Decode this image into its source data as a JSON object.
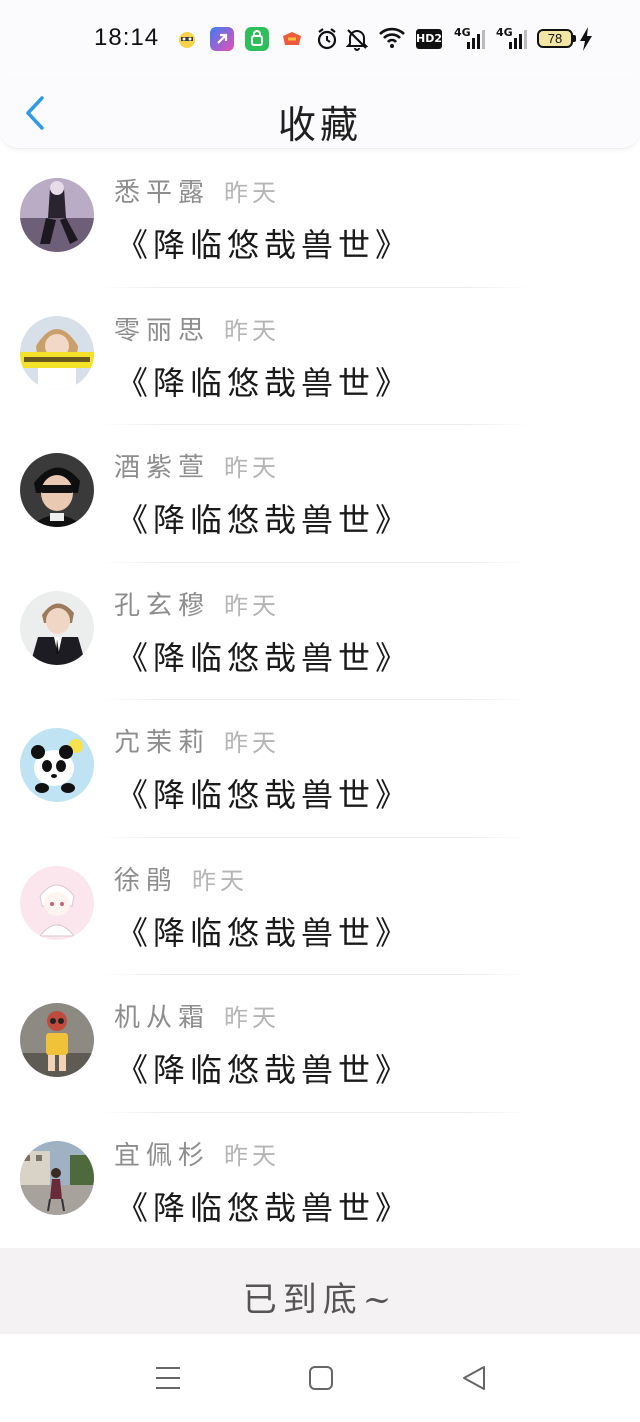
{
  "status_bar": {
    "time": "18:14",
    "hd_label": "HD2",
    "network_1": "4G",
    "network_2": "4G",
    "battery": "78"
  },
  "header": {
    "title": "收藏"
  },
  "items": [
    {
      "name": "悉平露",
      "time": "昨天",
      "title": "《降临悠哉兽世》"
    },
    {
      "name": "零丽思",
      "time": "昨天",
      "title": "《降临悠哉兽世》"
    },
    {
      "name": "酒紫萱",
      "time": "昨天",
      "title": "《降临悠哉兽世》"
    },
    {
      "name": "孔玄穆",
      "time": "昨天",
      "title": "《降临悠哉兽世》"
    },
    {
      "name": "宂茉莉",
      "time": "昨天",
      "title": "《降临悠哉兽世》"
    },
    {
      "name": "徐鹃",
      "time": "昨天",
      "title": "《降临悠哉兽世》"
    },
    {
      "name": "机从霜",
      "time": "昨天",
      "title": "《降临悠哉兽世》"
    },
    {
      "name": "宜佩杉",
      "time": "昨天",
      "title": "《降临悠哉兽世》"
    }
  ],
  "footer": {
    "end_text": "已到底~"
  },
  "colors": {
    "accent": "#2f9be6",
    "name_gray": "#8d8d8d",
    "time_gray": "#b5b5b5",
    "footer_bg": "#f4f2f2"
  },
  "icons": {
    "back": "chevron-left-icon",
    "nav_menu": "menu-icon",
    "nav_home": "home-icon",
    "nav_back": "back-triangle-icon"
  }
}
